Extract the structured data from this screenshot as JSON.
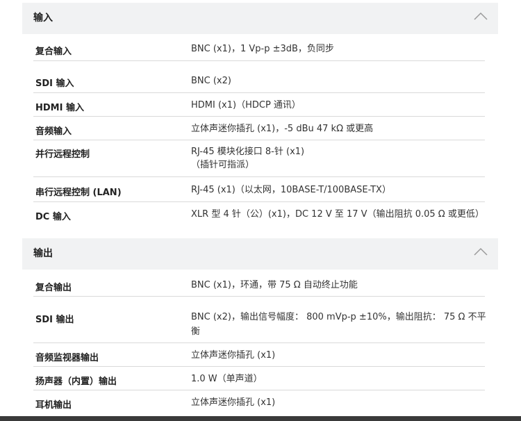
{
  "sections": [
    {
      "title": "输入",
      "rows": [
        {
          "label": "复合输入",
          "value": "BNC (x1)，1 Vp-p ±3dB，负同步"
        },
        {
          "label": "SDI 输入",
          "value": "BNC (x2)"
        },
        {
          "label": "HDMI 输入",
          "value": "HDMI (x1)（HDCP 通讯）"
        },
        {
          "label": "音频输入",
          "value": "立体声迷你插孔 (x1)，-5 dBu 47 kΩ 或更高"
        },
        {
          "label": "并行远程控制",
          "value": "RJ-45 模块化接口 8-针 (x1)",
          "value2": "（插针可指派）"
        },
        {
          "label": "串行远程控制 (LAN)",
          "value": "RJ-45 (x1)（以太网，10BASE-T/100BASE-TX）"
        },
        {
          "label": "DC 输入",
          "value": "XLR 型 4 针（公）(x1)，DC 12 V 至 17 V（输出阻抗 0.05 Ω 或更低）"
        }
      ]
    },
    {
      "title": "输出",
      "rows": [
        {
          "label": "复合输出",
          "value": "BNC (x1)，环通，带 75 Ω 自动终止功能"
        },
        {
          "label": "SDI 输出",
          "value": "BNC (x2)，输出信号幅度： 800 mVp-p ±10%，输出阻抗： 75 Ω 不平",
          "value2": "衡"
        },
        {
          "label": "音频监视器输出",
          "value": "立体声迷你插孔 (x1)"
        },
        {
          "label": "扬声器（内置）输出",
          "value": "1.0 W（单声道）"
        },
        {
          "label": "耳机输出",
          "value": "立体声迷你插孔 (x1)"
        }
      ]
    }
  ]
}
